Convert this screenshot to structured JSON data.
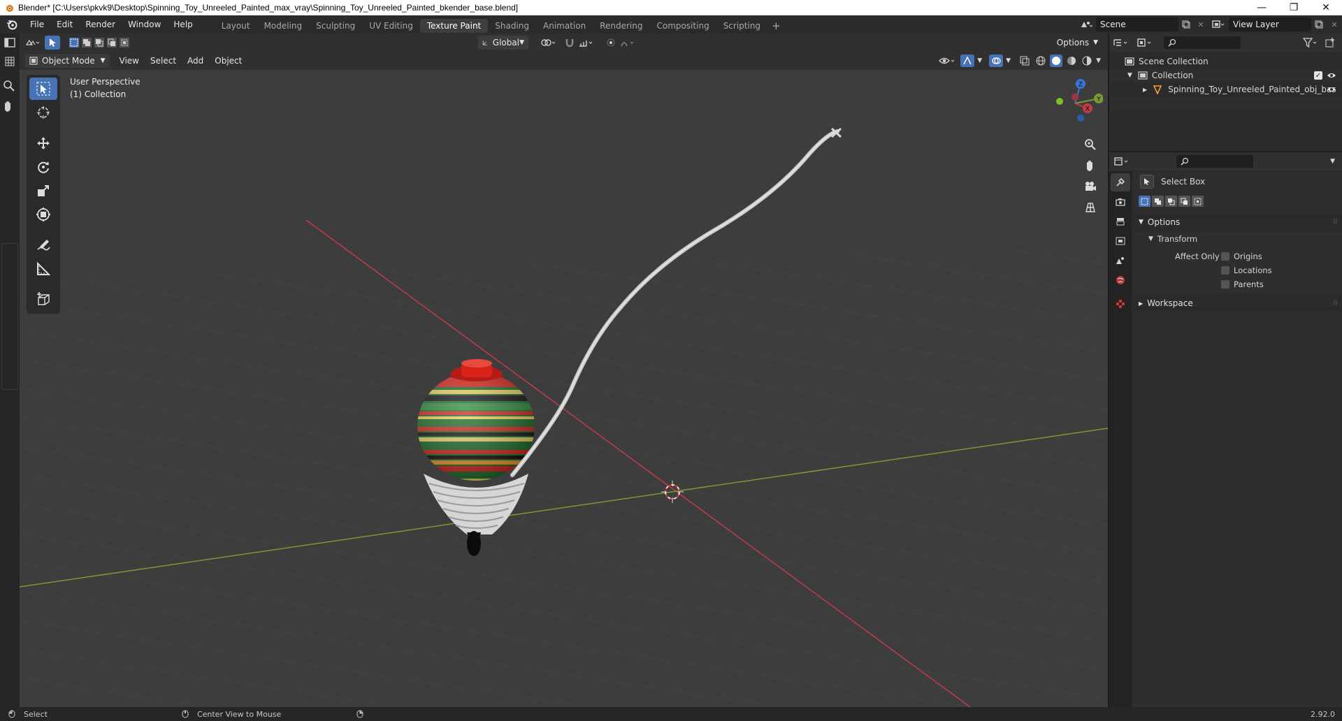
{
  "window": {
    "title": "Blender* [C:\\Users\\pkvk9\\Desktop\\Spinning_Toy_Unreeled_Painted_max_vray\\Spinning_Toy_Unreeled_Painted_bkender_base.blend]",
    "minimize": "—",
    "maximize": "❐",
    "close": "✕"
  },
  "menu": [
    "File",
    "Edit",
    "Render",
    "Window",
    "Help"
  ],
  "workspaces": [
    "Layout",
    "Modeling",
    "Sculpting",
    "UV Editing",
    "Texture Paint",
    "Shading",
    "Animation",
    "Rendering",
    "Compositing",
    "Scripting"
  ],
  "active_workspace": "Texture Paint",
  "add_workspace": "+",
  "scene": {
    "name": "Scene",
    "view_layer": "View Layer"
  },
  "viewport_header": {
    "transform_orientation": "Global",
    "options": "Options",
    "mode": "Object Mode",
    "menus": [
      "View",
      "Select",
      "Add",
      "Object"
    ]
  },
  "viewport": {
    "perspective_label": "User Perspective",
    "collection_label": "(1) Collection",
    "gizmo_axes": [
      "Z",
      "Y",
      "X"
    ]
  },
  "outliner": {
    "search_placeholder": "",
    "rows": [
      {
        "label": "Scene Collection"
      },
      {
        "label": "Collection"
      },
      {
        "label": "Spinning_Toy_Unreeled_Painted_obj_bas"
      }
    ]
  },
  "properties": {
    "tool_name": "Select Box",
    "panel_options": "Options",
    "subpanel_transform": "Transform",
    "affect_only": "Affect Only",
    "checkboxes": [
      "Origins",
      "Locations",
      "Parents"
    ],
    "panel_workspace": "Workspace"
  },
  "status": {
    "select": "Select",
    "center_view": "Center View to Mouse",
    "version": "2.92.0"
  },
  "colors": {
    "accent": "#4772b3",
    "x_axis": "#c13b48",
    "y_axis": "#7a9a33",
    "z_axis": "#3a74d6"
  }
}
